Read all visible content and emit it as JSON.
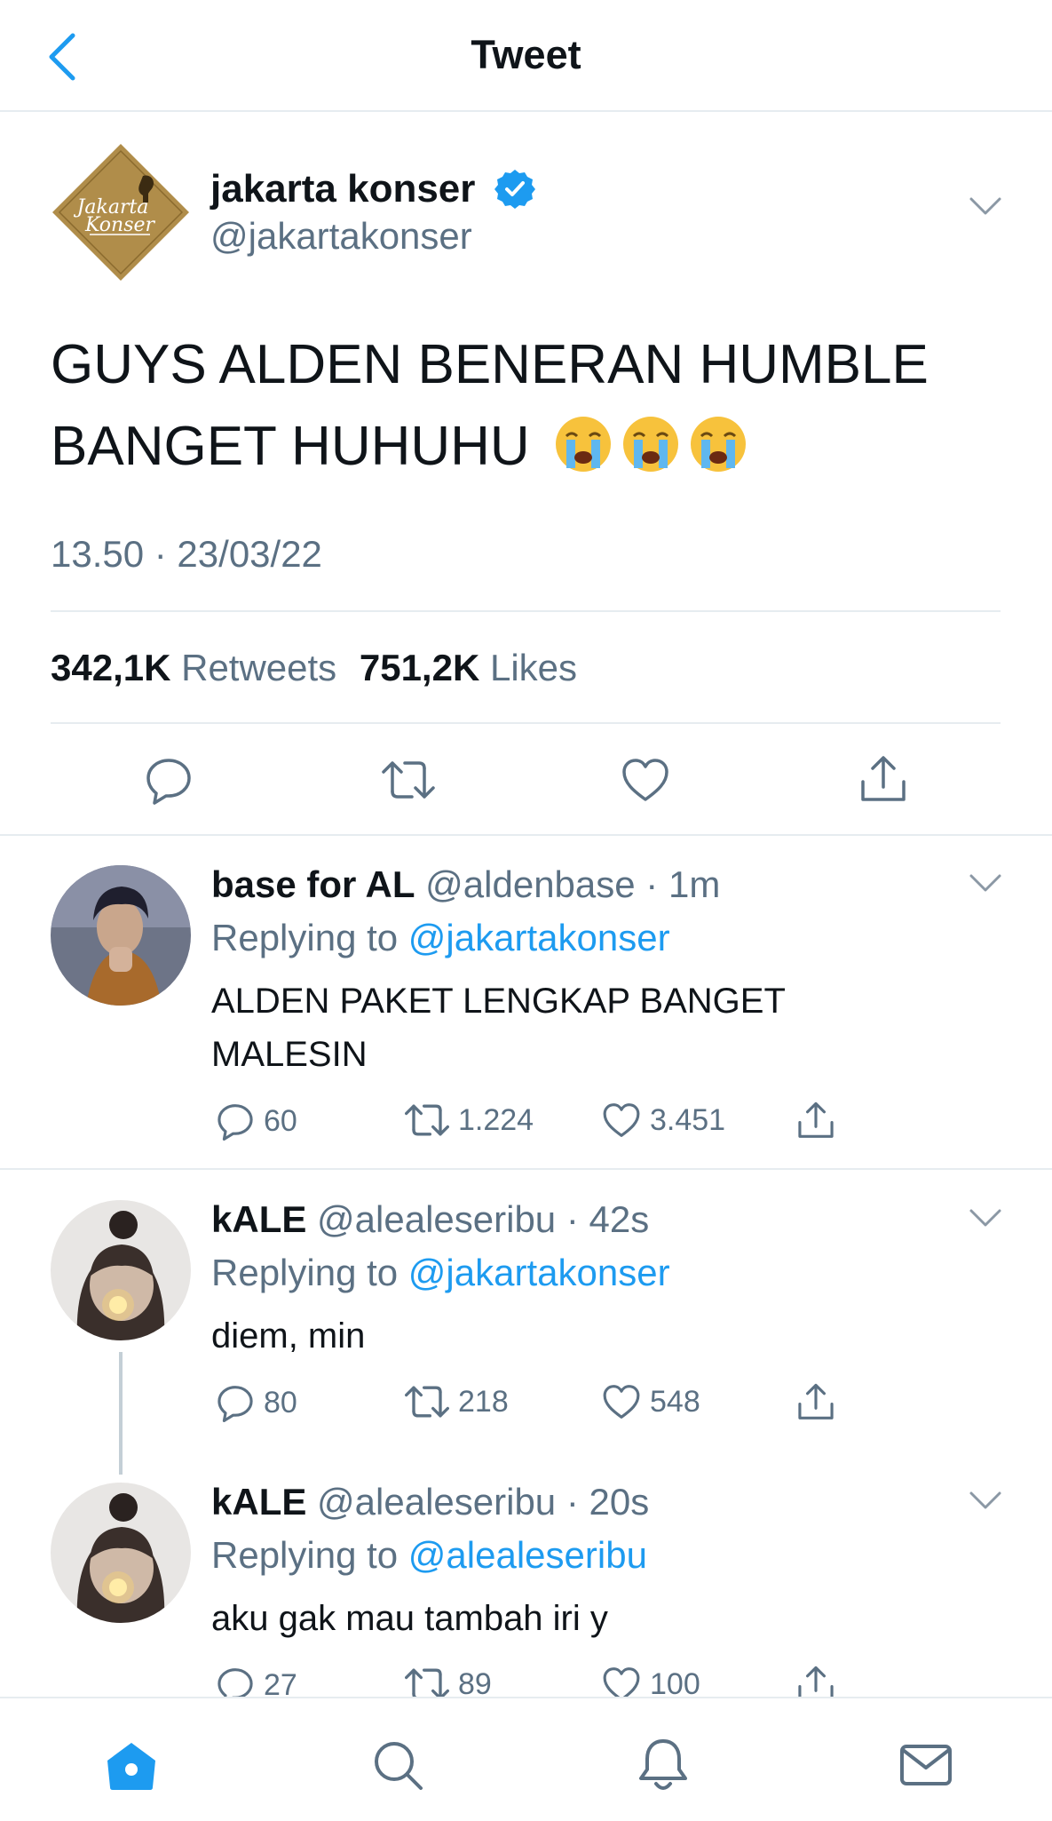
{
  "header": {
    "title": "Tweet"
  },
  "main_tweet": {
    "display_name": "jakarta konser",
    "handle": "@jakartakonser",
    "logo_text_line1": "Jakarta",
    "logo_text_line2": "Konser",
    "text": "GUYS ALDEN BENERAN HUMBLE BANGET HUHUHU",
    "emoji_count": 3,
    "timestamp": "13.50 · 23/03/22",
    "retweets_count": "342,1K",
    "retweets_label": "Retweets",
    "likes_count": "751,2K",
    "likes_label": "Likes"
  },
  "replies": [
    {
      "display_name": "base for AL",
      "meta": "@aldenbase · 1m",
      "replying_prefix": "Replying to",
      "replying_to": "@jakartakonser",
      "text": "ALDEN PAKET LENGKAP BANGET MALESIN",
      "reply_count": "60",
      "retweet_count": "1.224",
      "like_count": "3.451"
    },
    {
      "display_name": "kALE",
      "meta": "@alealeseribu · 42s",
      "replying_prefix": "Replying to",
      "replying_to": "@jakartakonser",
      "text": "diem, min",
      "reply_count": "80",
      "retweet_count": "218",
      "like_count": "548"
    },
    {
      "display_name": "kALE",
      "meta": "@alealeseribu · 20s",
      "replying_prefix": "Replying to",
      "replying_to": "@alealeseribu",
      "text": "aku gak mau tambah iri y",
      "reply_count": "27",
      "retweet_count": "89",
      "like_count": "100"
    }
  ],
  "colors": {
    "accent": "#1d9bf0",
    "secondary_text": "#5b7083",
    "divider": "#e6ecf0",
    "logo_gold": "#b08d4a"
  },
  "icons": {
    "header": [
      "back-chevron-icon"
    ],
    "actions": [
      "reply-icon",
      "retweet-icon",
      "like-icon",
      "share-icon"
    ],
    "nav": [
      "home-icon",
      "search-icon",
      "notifications-icon",
      "messages-icon"
    ]
  }
}
